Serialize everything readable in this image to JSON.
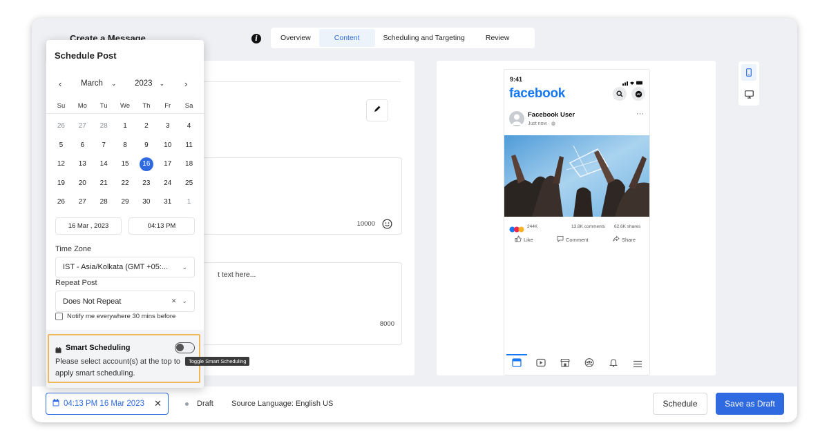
{
  "header": {
    "title": "Create a Message",
    "tabs": [
      {
        "label": "Overview"
      },
      {
        "label": "Content"
      },
      {
        "label": "Scheduling and Targeting"
      },
      {
        "label": "Review"
      }
    ],
    "active_tab": "Content"
  },
  "editor": {
    "text_counter": "10000",
    "placeholder": "t text here...",
    "comment_counter": "8000"
  },
  "preview": {
    "status_time": "9:41",
    "brand": "facebook",
    "user_name": "Facebook User",
    "post_time": "Just now · ",
    "reactions": "244K",
    "comments": "13.8K comments",
    "shares": "62.6K shares",
    "like": "Like",
    "comment": "Comment",
    "share": "Share"
  },
  "schedule": {
    "title": "Schedule Post",
    "month": "March",
    "year": "2023",
    "weekdays": [
      "Su",
      "Mo",
      "Tu",
      "We",
      "Th",
      "Fr",
      "Sa"
    ],
    "weeks": [
      [
        "26",
        "27",
        "28",
        "1",
        "2",
        "3",
        "4"
      ],
      [
        "5",
        "6",
        "7",
        "8",
        "9",
        "10",
        "11"
      ],
      [
        "12",
        "13",
        "14",
        "15",
        "16",
        "17",
        "18"
      ],
      [
        "19",
        "20",
        "21",
        "22",
        "23",
        "24",
        "25"
      ],
      [
        "26",
        "27",
        "28",
        "29",
        "30",
        "31",
        "1"
      ]
    ],
    "selected_day": "16",
    "date_value": "16 Mar , 2023",
    "time_value": "04:13  PM",
    "timezone_label": "Time Zone",
    "timezone_value": "IST - Asia/Kolkata (GMT +05:...",
    "repeat_label": "Repeat Post",
    "repeat_value": "Does Not Repeat",
    "notify_label": "Notify me everywhere 30 mins before",
    "smart_title": "Smart Scheduling",
    "smart_desc_1": "Please select account(s) at the top to",
    "smart_desc_2": "apply smart scheduling.",
    "tooltip": "Toggle Smart Scheduling"
  },
  "footer": {
    "schedule_chip": "04:13 PM 16 Mar 2023",
    "status": "Draft",
    "source_language": "Source Language: English US",
    "schedule_button": "Schedule",
    "save_draft_button": "Save as Draft"
  },
  "colors": {
    "accent": "#2f6ae0",
    "highlight_border": "#f0b65a",
    "facebook_blue": "#1877f2"
  }
}
